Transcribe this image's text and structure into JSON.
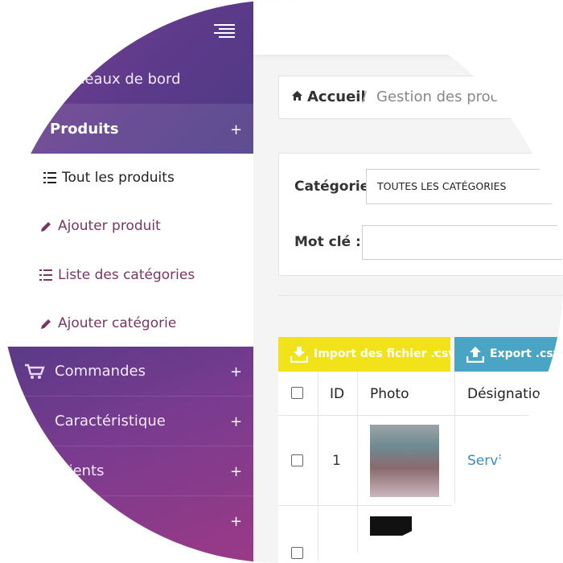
{
  "sidebar": {
    "dashboard_label": "Tableaux de bord",
    "produits_label": "Produits",
    "plus": "+",
    "submenu": [
      {
        "label": "Tout les produits",
        "icon": "list-icon"
      },
      {
        "label": "Ajouter produit",
        "icon": "pencil-icon"
      },
      {
        "label": "Liste des catégories",
        "icon": "list-icon"
      },
      {
        "label": "Ajouter catégorie",
        "icon": "pencil-icon"
      }
    ],
    "commandes_label": "Commandes",
    "caracteristique_label": "Caractéristique",
    "row3_label": "Clients"
  },
  "breadcrumb": {
    "home": "Accueil",
    "separator": "/",
    "current": "Gestion des produits"
  },
  "filters": {
    "category_label": "Catégorie :",
    "category_value": "TOUTES LES CATÉGORIES",
    "keyword_label": "Mot clé :",
    "keyword_value": ""
  },
  "actions": {
    "import_label": "Import des fichier .csv",
    "export_label": "Export .csv"
  },
  "table": {
    "headers": [
      "ID",
      "Photo",
      "Désignation"
    ],
    "rows": [
      {
        "id": "1",
        "designation": "Serviettes"
      }
    ]
  },
  "colors": {
    "sidebar_purple": "#5b3a8a",
    "accent_magenta": "#7b3564",
    "import_yellow": "#f1e219",
    "export_blue": "#4aa4c3"
  }
}
